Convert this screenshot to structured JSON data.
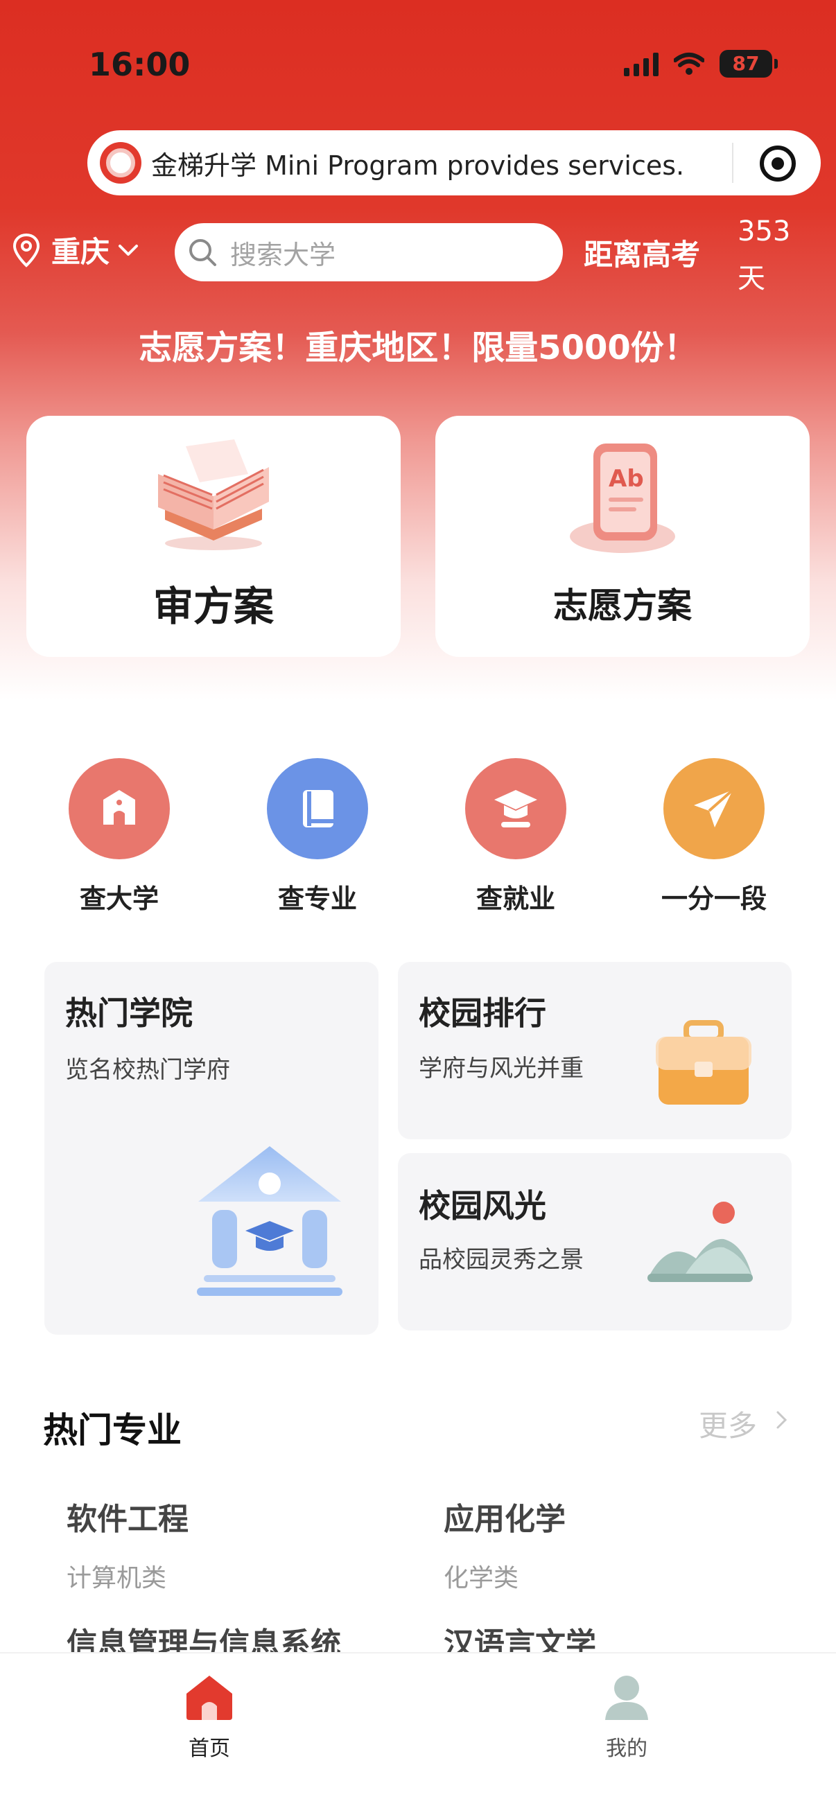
{
  "status_bar": {
    "time": "16:00",
    "battery": "87"
  },
  "mini_program": {
    "name_text": "金梯升学  Mini Program provides services."
  },
  "header": {
    "location": "重庆",
    "search_placeholder": "搜索大学",
    "countdown_label": "距离高考",
    "countdown_value": "353",
    "countdown_unit": "天"
  },
  "promo": "志愿方案！重庆地区！限量5000份！",
  "cards": [
    {
      "label": "审方案"
    },
    {
      "label": "志愿方案"
    }
  ],
  "quick_actions": [
    {
      "label": "查大学",
      "icon": "university-icon",
      "color": "#e8776d"
    },
    {
      "label": "查专业",
      "icon": "book-icon",
      "color": "#6b93e6"
    },
    {
      "label": "查就业",
      "icon": "graduation-cap-icon",
      "color": "#e8776d"
    },
    {
      "label": "一分一段",
      "icon": "paper-plane-icon",
      "color": "#f0a54a"
    }
  ],
  "tiles": {
    "hot_colleges": {
      "title": "热门学院",
      "subtitle": "览名校热门学府"
    },
    "campus_rank": {
      "title": "校园排行",
      "subtitle": "学府与风光并重"
    },
    "campus_scenery": {
      "title": "校园风光",
      "subtitle": "品校园灵秀之景"
    }
  },
  "hot_majors": {
    "title": "热门专业",
    "more": "更多",
    "items": [
      {
        "name": "软件工程",
        "category": "计算机类"
      },
      {
        "name": "应用化学",
        "category": "化学类"
      },
      {
        "name": "信息管理与信息系统",
        "category": ""
      },
      {
        "name": "汉语言文学",
        "category": ""
      }
    ]
  },
  "tabbar": {
    "items": [
      {
        "label": "首页",
        "active": true
      },
      {
        "label": "我的",
        "active": false
      }
    ]
  },
  "colors": {
    "brand_red": "#dc2e22",
    "tab_active": "#e23a2e"
  }
}
